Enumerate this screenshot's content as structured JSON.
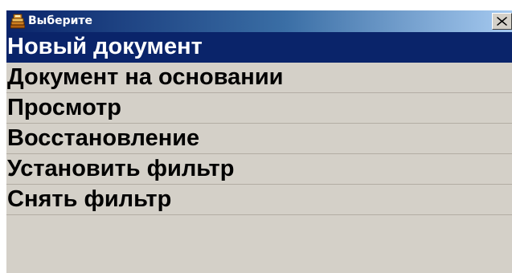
{
  "window": {
    "title": "Выберите",
    "icon": "cash-register-icon",
    "close_icon": "close-icon",
    "close_label": "×"
  },
  "menu": {
    "selected_index": 0,
    "items": [
      {
        "label": "Новый документ"
      },
      {
        "label": "Документ на основании"
      },
      {
        "label": "Просмотр"
      },
      {
        "label": "Восстановление"
      },
      {
        "label": "Установить фильтр"
      },
      {
        "label": "Снять фильтр"
      }
    ]
  },
  "colors": {
    "selection": "#0a246a",
    "menu_background": "#d4d0c8",
    "title_gradient_start": "#0a246a",
    "title_gradient_end": "#a6caf0"
  }
}
